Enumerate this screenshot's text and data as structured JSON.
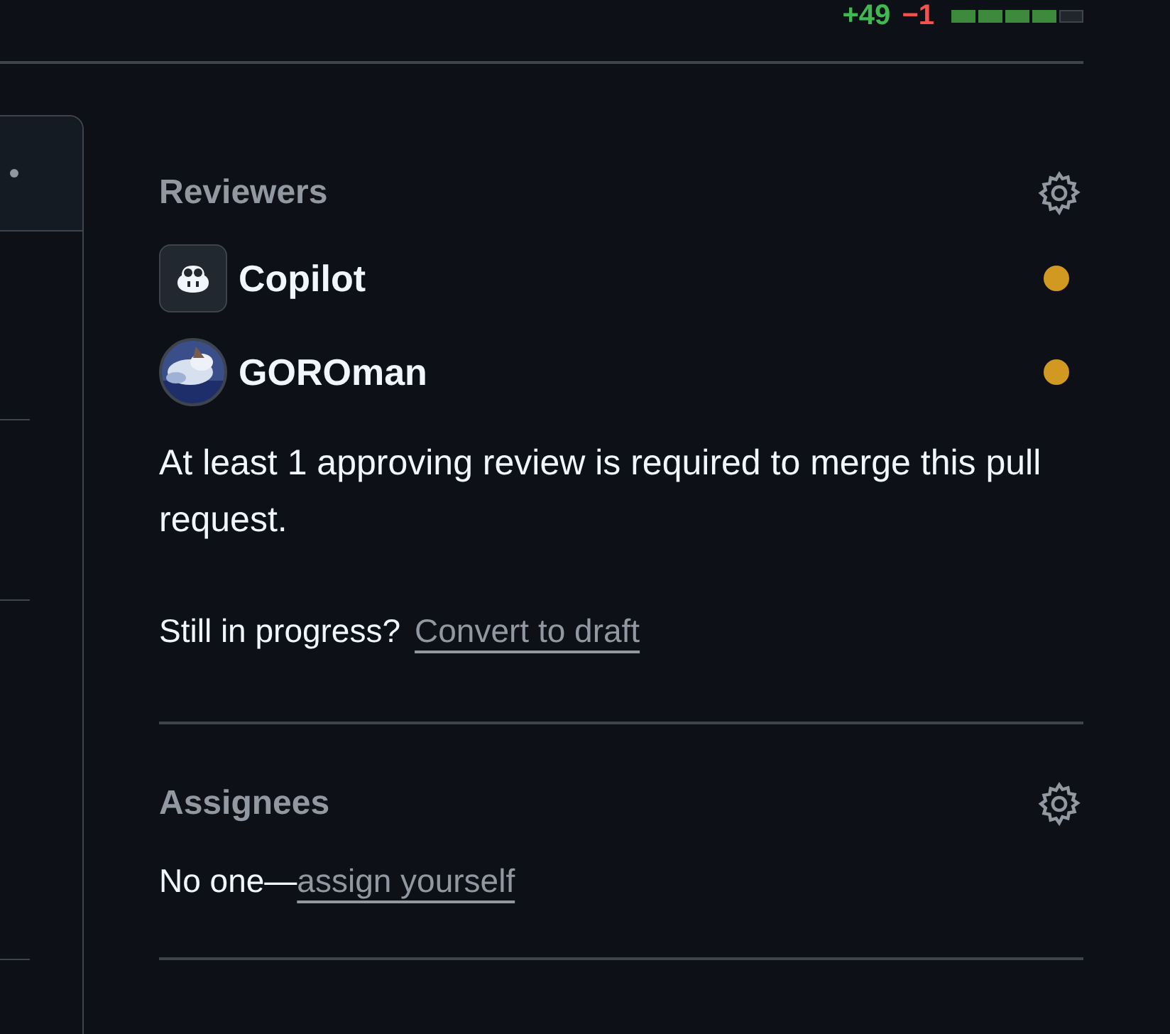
{
  "diffstat": {
    "additions": "+49",
    "deletions": "−1",
    "blocks": [
      {
        "kind": "added"
      },
      {
        "kind": "added"
      },
      {
        "kind": "added"
      },
      {
        "kind": "added"
      },
      {
        "kind": "neutral"
      }
    ]
  },
  "reviewers": {
    "title": "Reviewers",
    "people": [
      {
        "name": "Copilot",
        "kind": "bot",
        "color": "#d29922"
      },
      {
        "name": "GOROman",
        "kind": "user",
        "color": "#d29922"
      }
    ],
    "note": "At least 1 approving review is required to merge this pull request.",
    "draft_prompt": "Still in progress?",
    "draft_link": "Convert to draft"
  },
  "assignees": {
    "title": "Assignees",
    "empty_text": "No one—",
    "assign_link": "assign yourself"
  }
}
